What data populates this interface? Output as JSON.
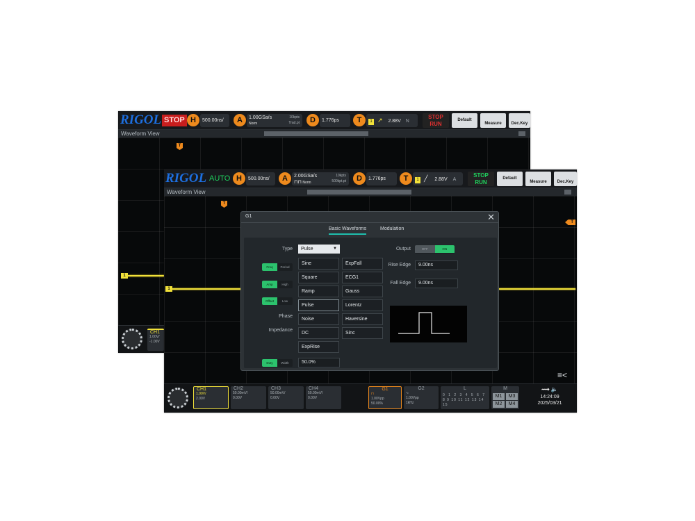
{
  "back_screen": {
    "logo": "RIGOL",
    "run_state": "STOP",
    "horizontal": {
      "badge": "H",
      "timebase": "500.00ns/"
    },
    "acquire": {
      "badge": "A",
      "sample_rate": "1.00GSa/s",
      "mode": "Norm",
      "points": "10kpts",
      "points_sub": "Trad.pt"
    },
    "delay": {
      "badge": "D",
      "value": "1.776ps"
    },
    "trigger": {
      "badge": "T",
      "channel": "1",
      "level": "2.88V",
      "coupling": "N"
    },
    "buttons": {
      "stop_run": "STOP\nRUN",
      "default": "Default",
      "measure": "Measure",
      "dec_key": "Dec.Key"
    },
    "waveform_title": "Waveform View",
    "trigger_marker": "T",
    "ch1_marker": "1",
    "ch1_panel": {
      "name": "CH1",
      "scale": "1.00V/",
      "offset": "-1.00V"
    }
  },
  "front_screen": {
    "logo": "RIGOL",
    "run_state": "AUTO",
    "horizontal": {
      "badge": "H",
      "timebase": "500.00ns/"
    },
    "acquire": {
      "badge": "A",
      "sample_rate": "2.00GSa/s",
      "mode": "Norm",
      "points": "10kpts",
      "points_sub": "500kpt.pt"
    },
    "delay": {
      "badge": "D",
      "value": "1.776ps"
    },
    "trigger": {
      "badge": "T",
      "channel": "1",
      "level": "2.88V",
      "coupling": "A"
    },
    "buttons": {
      "stop": "STOP",
      "run": "RUN",
      "default": "Default",
      "measure": "Measure",
      "dec_key": "Dec.Key"
    },
    "waveform_title": "Waveform View",
    "trigger_marker": "T",
    "right_marker": "T",
    "ch1_marker": "1",
    "menu_icon": "≡<",
    "channels": [
      {
        "name": "CH1",
        "scale": "1.00V/",
        "offset": "2.00V"
      },
      {
        "name": "CH2",
        "scale": "50.00mV/",
        "offset": "0.00V"
      },
      {
        "name": "CH3",
        "scale": "50.00mV/",
        "offset": "0.00V"
      },
      {
        "name": "CH4",
        "scale": "50.00mV/",
        "offset": "0.00V"
      }
    ],
    "g1_panel": {
      "name": "G1",
      "amp": "1.00Vpp",
      "freq": "50.00%"
    },
    "g2_panel": {
      "name": "G2",
      "amp": "1.00Vpp",
      "freq": "1kHz"
    },
    "l_panel": {
      "name": "L",
      "row1": [
        "0",
        "1",
        "2",
        "3",
        "4",
        "5",
        "6",
        "7"
      ],
      "row2": [
        "8",
        "9",
        "10",
        "11",
        "12",
        "13",
        "14",
        "15"
      ]
    },
    "m_panel": {
      "name": "M",
      "items": [
        "M1",
        "M3",
        "M2",
        "M4"
      ]
    },
    "status": {
      "usb_icon": "USB",
      "speaker_icon": "speaker",
      "time": "14:24:09",
      "date": "2025/03/21"
    }
  },
  "dialog": {
    "title": "G1",
    "tabs": [
      "Basic Waveforms",
      "Modulation"
    ],
    "active_tab": "Basic Waveforms",
    "type_label": "Type",
    "type_value": "Pulse",
    "toggles": [
      {
        "on": "Freq",
        "off": "Period"
      },
      {
        "on": "Amp",
        "off": "High"
      },
      {
        "on": "Offset",
        "off": "Low"
      },
      {
        "on": "Duty",
        "off": "Width"
      }
    ],
    "phase_label": "Phase",
    "impedance_label": "Impedance",
    "waveforms_col1": [
      "Sine",
      "Square",
      "Ramp",
      "Pulse",
      "Noise",
      "DC",
      "ExpRise"
    ],
    "waveforms_col2": [
      "ExpFall",
      "ECG1",
      "Gauss",
      "Lorentz",
      "Haversine",
      "Sinc"
    ],
    "duty_value": "50.0%",
    "output_label": "Output",
    "output_toggle": {
      "off": "OFF",
      "on": "ON"
    },
    "rise_edge_label": "Rise Edge",
    "rise_edge_value": "9.00ns",
    "fall_edge_label": "Fall Edge",
    "fall_edge_value": "9.00ns"
  },
  "colors": {
    "accent_orange": "#ee8a1d",
    "ch1_yellow": "#f2e23a",
    "logo_blue": "#1d6fe0",
    "toggle_green": "#2cc26d",
    "tab_teal": "#1fbfae"
  }
}
